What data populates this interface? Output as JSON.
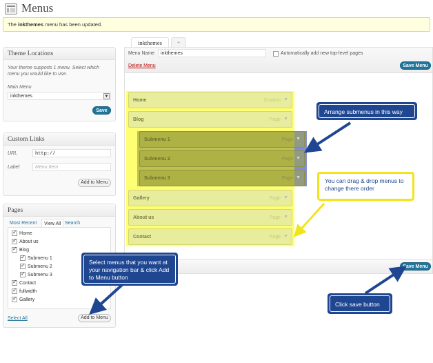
{
  "header": {
    "title": "Menus",
    "icon": "menus-icon"
  },
  "notice": {
    "menu_name": "inkthemes",
    "message": " menu has been updated."
  },
  "theme_locations": {
    "title": "Theme Locations",
    "description": "Your theme supports 1 menu. Select which menu you would like to use.",
    "main_menu_label": "Main Menu",
    "main_menu_value": "inkthemes",
    "save_label": "Save"
  },
  "custom_links": {
    "title": "Custom Links",
    "url_label": "URL",
    "url_value": "http://",
    "label_label": "Label",
    "label_placeholder": "Menu Item",
    "add_label": "Add to Menu"
  },
  "pages": {
    "title": "Pages",
    "tabs": [
      "Most Recent",
      "View All",
      "Search"
    ],
    "active_tab": "View All",
    "items": [
      {
        "label": "Home",
        "checked": true
      },
      {
        "label": "About us",
        "checked": true
      },
      {
        "label": "Blog",
        "checked": true
      },
      {
        "label": "Submenu 1",
        "checked": true
      },
      {
        "label": "Submenu 2",
        "checked": true
      },
      {
        "label": "Submenu 3",
        "checked": true
      },
      {
        "label": "Contact",
        "checked": true
      },
      {
        "label": "fullwidth",
        "checked": true
      },
      {
        "label": "Gallery",
        "checked": true
      }
    ],
    "select_all_label": "Select All",
    "add_label": "Add to Menu"
  },
  "menu_tabs": {
    "active": "inkthemes",
    "add": "+"
  },
  "menu_editor": {
    "name_label": "Menu Name",
    "name_value": "inkthemes",
    "auto_add_label": "Automatically add new top-level pages",
    "delete_label": "Delete Menu",
    "save_label": "Save Menu",
    "items": [
      {
        "title": "Home",
        "type": "Custom"
      },
      {
        "title": "Blog",
        "type": "Page"
      },
      {
        "title": "Submenu 1",
        "type": "Page"
      },
      {
        "title": "Submenu 2",
        "type": "Page"
      },
      {
        "title": "Submenu 3",
        "type": "Page"
      },
      {
        "title": "Gallery",
        "type": "Page"
      },
      {
        "title": "About us",
        "type": "Page"
      },
      {
        "title": "Contact",
        "type": "Page"
      }
    ]
  },
  "annotations": {
    "submenus": "Arrange submenus in this way",
    "drag_drop": "You can drag & drop menus to change there order",
    "select_menus": "Select menus that you want at your navigation bar & click Add to Menu button",
    "save": "Click save button"
  },
  "colors": {
    "accent": "#21759b",
    "callout_bg": "#1f4690",
    "callout_border_yellow": "#f2e41a",
    "highlight_yellow": "#ffff00",
    "highlight_blue": "#5866c8",
    "notice_bg": "#ffffe0"
  }
}
